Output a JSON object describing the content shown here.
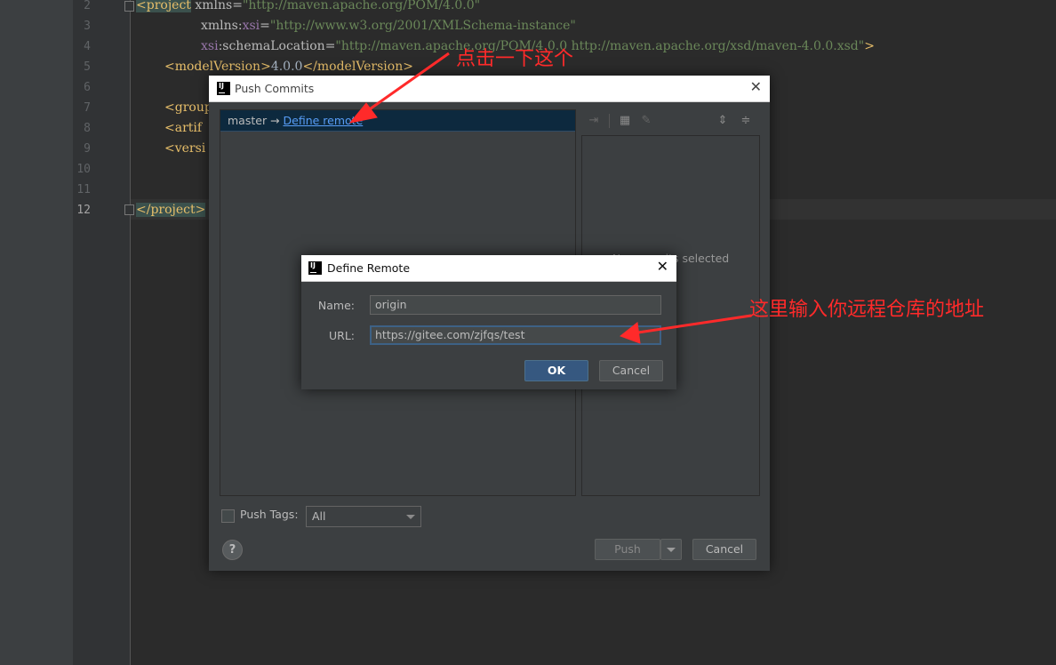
{
  "editor": {
    "lines": [
      {
        "num": "2"
      },
      {
        "num": "3"
      },
      {
        "num": "4"
      },
      {
        "num": "5"
      },
      {
        "num": "6"
      },
      {
        "num": "7"
      },
      {
        "num": "8"
      },
      {
        "num": "9"
      },
      {
        "num": "10"
      },
      {
        "num": "11"
      },
      {
        "num": "12"
      }
    ],
    "code": {
      "l2_tag": "<project",
      "l2_attr": " xmlns=",
      "l2_val": "\"http://maven.apache.org/POM/4.0.0\"",
      "l3_ns": "xmlns",
      "l3_colon": ":",
      "l3_attr": "xsi",
      "l3_eq": "=",
      "l3_val": "\"http://www.w3.org/2001/XMLSchema-instance\"",
      "l4_ns": "xsi",
      "l4_attr": ":schemaLocation=",
      "l4_val": "\"http://maven.apache.org/POM/4.0.0 http://maven.apache.org/xsd/maven-4.0.0.xsd\"",
      "l4_end": ">",
      "l5_open": "<modelVersion>",
      "l5_text": "4.0.0",
      "l5_close": "</modelVersion>",
      "l7_tag": "<group",
      "l8_tag": "<artif",
      "l9_tag": "<versi",
      "l12_tag": "</project>"
    }
  },
  "push_dialog": {
    "title": "Push Commits",
    "branch": "master → ",
    "define_remote_link": "Define remote",
    "right_pane_empty_text": "No commits selected",
    "push_tags_label": "Push Tags:",
    "push_tags_value": "All",
    "help_label": "?",
    "push_button": "Push",
    "cancel_button": "Cancel"
  },
  "define_remote_dialog": {
    "title": "Define Remote",
    "name_label": "Name:",
    "name_value": "origin",
    "url_label": "URL:",
    "url_value": "https://gitee.com/zjfqs/test",
    "ok_button": "OK",
    "cancel_button": "Cancel"
  },
  "annotations": {
    "click_this": "点击一下这个",
    "enter_url": "这里输入你远程仓库的地址",
    "color": "#ff2a2a"
  },
  "colors": {
    "editor_bg": "#2b2b2b",
    "dialog_bg": "#3c3f41",
    "selection": "#0d293e",
    "link": "#589df6",
    "ok_button": "#365880"
  }
}
